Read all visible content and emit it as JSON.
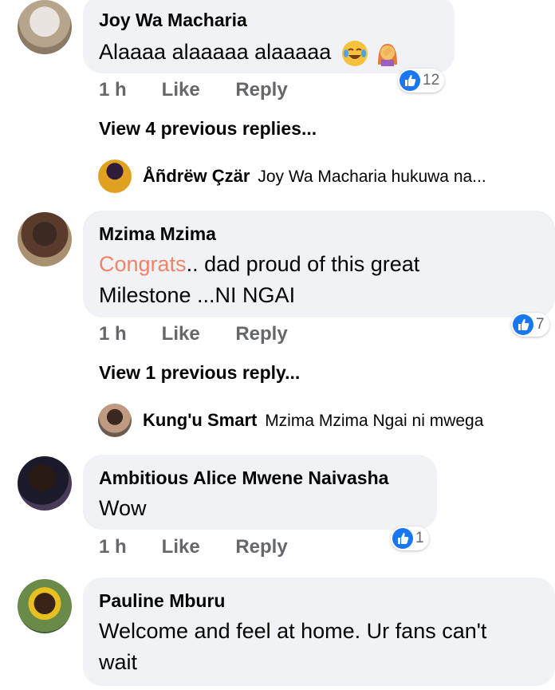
{
  "colors": {
    "bubble": "#f0f2f5",
    "like_blue": "#1877f2",
    "meta_gray": "#65676b",
    "congrats_orange": "#f0846a"
  },
  "comments": [
    {
      "author": "Joy Wa Macharia",
      "text": "Alaaaa alaaaaa alaaaaa",
      "emojis": [
        "joy-emoji",
        "facepalm-emoji"
      ],
      "time": "1 h",
      "like": "Like",
      "reply": "Reply",
      "reactions": "12",
      "view_replies": "View 4 previous replies...",
      "last_reply": {
        "author": "Åñdrëw Çzär",
        "text": "Joy Wa Macharia hukuwa na..."
      }
    },
    {
      "author": "Mzima Mzima",
      "text_highlight": "Congrats",
      "text_line1": ".. dad   proud of this great",
      "text_line2": "Milestone  ...NI NGAI",
      "time": "1 h",
      "like": "Like",
      "reply": "Reply",
      "reactions": "7",
      "view_replies": "View 1 previous reply...",
      "last_reply": {
        "author": "Kung'u Smart",
        "text": "Mzima Mzima Ngai ni mwega"
      }
    },
    {
      "author": "Ambitious Alice Mwene Naivasha",
      "text": "Wow",
      "time": "1 h",
      "like": "Like",
      "reply": "Reply",
      "reactions": "1"
    },
    {
      "author": "Pauline Mburu",
      "text_line1": "Welcome and feel at home. Ur fans can't",
      "text_line2": "wait"
    }
  ]
}
